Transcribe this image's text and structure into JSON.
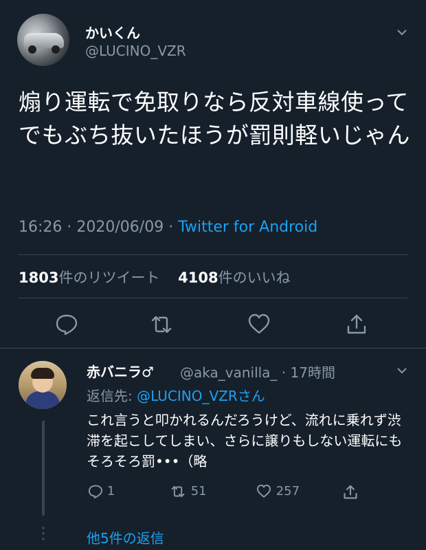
{
  "tweet": {
    "display_name": "かいくん",
    "handle": "@LUCINO_VZR",
    "text": "煽り運転で免取りなら反対車線使ってでもぶち抜いたほうが罰則軽いじゃん",
    "time": "16:26",
    "separator1": " · ",
    "date": "2020/06/09",
    "separator2": " · ",
    "source": "Twitter for Android",
    "retweet_count": "1803",
    "retweet_label": "件のリツイート",
    "like_count": "4108",
    "like_label": "件のいいね"
  },
  "actions": {
    "reply_icon": "reply-icon",
    "retweet_icon": "retweet-icon",
    "like_icon": "heart-icon",
    "share_icon": "share-icon"
  },
  "reply": {
    "display_name": "赤バニラ♂",
    "handle_time": "@aka_vanilla_ · 17時間",
    "reply_to_label": "返信先: ",
    "reply_to_handle": "@LUCINO_VZRさん",
    "text": "これ言うと叩かれるんだろうけど、流れに乗れず渋滞を起こしてしまい、さらに譲りもしない運転にもそろそろ罰•••（略",
    "reply_count": "1",
    "retweet_count": "51",
    "like_count": "257"
  },
  "more_replies": "他5件の返信",
  "colors": {
    "background": "#15202b",
    "text": "#ffffff",
    "secondary": "#8899a6",
    "accent": "#1da1f2",
    "divider": "#38444d"
  }
}
